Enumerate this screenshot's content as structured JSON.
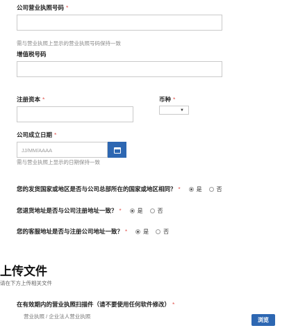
{
  "business_license": {
    "label": "公司营业执照号码",
    "required_mark": "*",
    "hint": "需与营业执照上显示的营业执照号码保持一致"
  },
  "vat": {
    "label": "增值税号码"
  },
  "registered_capital": {
    "label": "注册资本",
    "required_mark": "*"
  },
  "currency": {
    "label": "币种",
    "required_mark": "*",
    "selected": ""
  },
  "incorporation_date": {
    "label": "公司成立日期",
    "required_mark": "*",
    "placeholder": "JJ/MM/AAAA",
    "hint": "需与营业执照上显示的日期保持一致"
  },
  "questions": [
    {
      "text": "您的发货国家或地区是否与公司总部所在的国家或地区相同？",
      "required_mark": "*",
      "yes": "是",
      "no": "否",
      "selected": "yes"
    },
    {
      "text": "您退货地址是否与公司注册地址一致？",
      "required_mark": "*",
      "yes": "是",
      "no": "否",
      "selected": "yes"
    },
    {
      "text": "您的客服地址是否与注册公司地址一致？",
      "required_mark": "*",
      "yes": "是",
      "no": "否",
      "selected": "yes"
    }
  ],
  "upload": {
    "title": "上传文件",
    "subtitle": "请在下方上传相关文件",
    "doc_label": "在有效期内的营业执照扫描件（请不要使用任何软件修改）",
    "required_mark": "*",
    "doc_hint": "营业执照 / 企业法人营业执照",
    "browse_label": "浏览"
  },
  "colors": {
    "required": "#e0504b",
    "accent": "#2d67b2"
  },
  "icons": {
    "date_picker": "calendar-icon",
    "currency_dropdown": "caret-down-icon"
  }
}
